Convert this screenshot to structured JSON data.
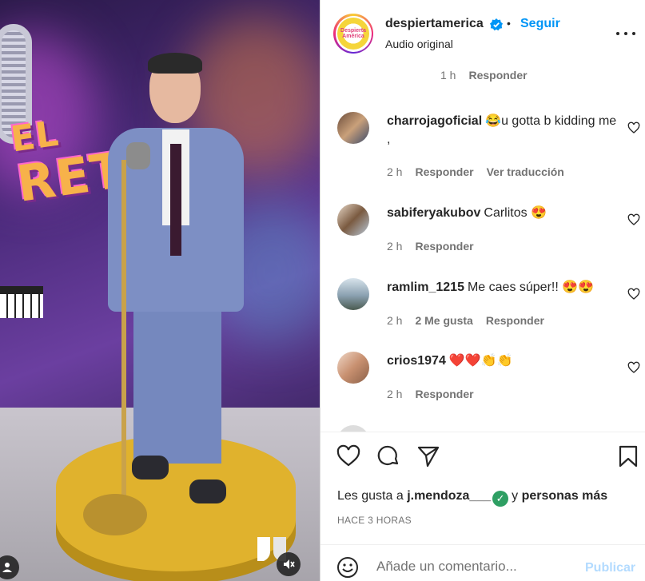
{
  "header": {
    "username": "despiertamerica",
    "avatar_text": "Despierta América",
    "dot": "•",
    "follow_label": "Seguir",
    "audio": "Audio original",
    "verified_icon": "verified-badge-icon",
    "more_icon": "more-options-icon"
  },
  "media": {
    "sign_line1": "EL",
    "sign_line2": "RET"
  },
  "prev_comment_meta": {
    "time": "1 h",
    "reply": "Responder"
  },
  "comments": [
    {
      "user": "charrojagoficial",
      "text": "😂u gotta b kidding me ,",
      "time": "2 h",
      "reply": "Responder",
      "translate": "Ver traducción"
    },
    {
      "user": "sabiferyakubov",
      "text": "Carlitos 😍",
      "time": "2 h",
      "reply": "Responder"
    },
    {
      "user": "ramlim_1215",
      "text": "Me caes súper!! 😍😍",
      "time": "2 h",
      "likes": "2 Me gusta",
      "reply": "Responder"
    },
    {
      "user": "crios1974",
      "text": "❤️❤️👏👏",
      "time": "2 h",
      "reply": "Responder"
    }
  ],
  "likes": {
    "prefix": "Les gusta a",
    "user": "j.mendoza___",
    "connector": "y",
    "others": "personas más"
  },
  "timestamp": "HACE 3 HORAS",
  "compose": {
    "placeholder": "Añade un comentario...",
    "publish_label": "Publicar"
  },
  "colors": {
    "accent": "#0095f6",
    "publish_disabled": "#b3dbff",
    "verified": "#0095f6",
    "muted_text": "#737373"
  }
}
